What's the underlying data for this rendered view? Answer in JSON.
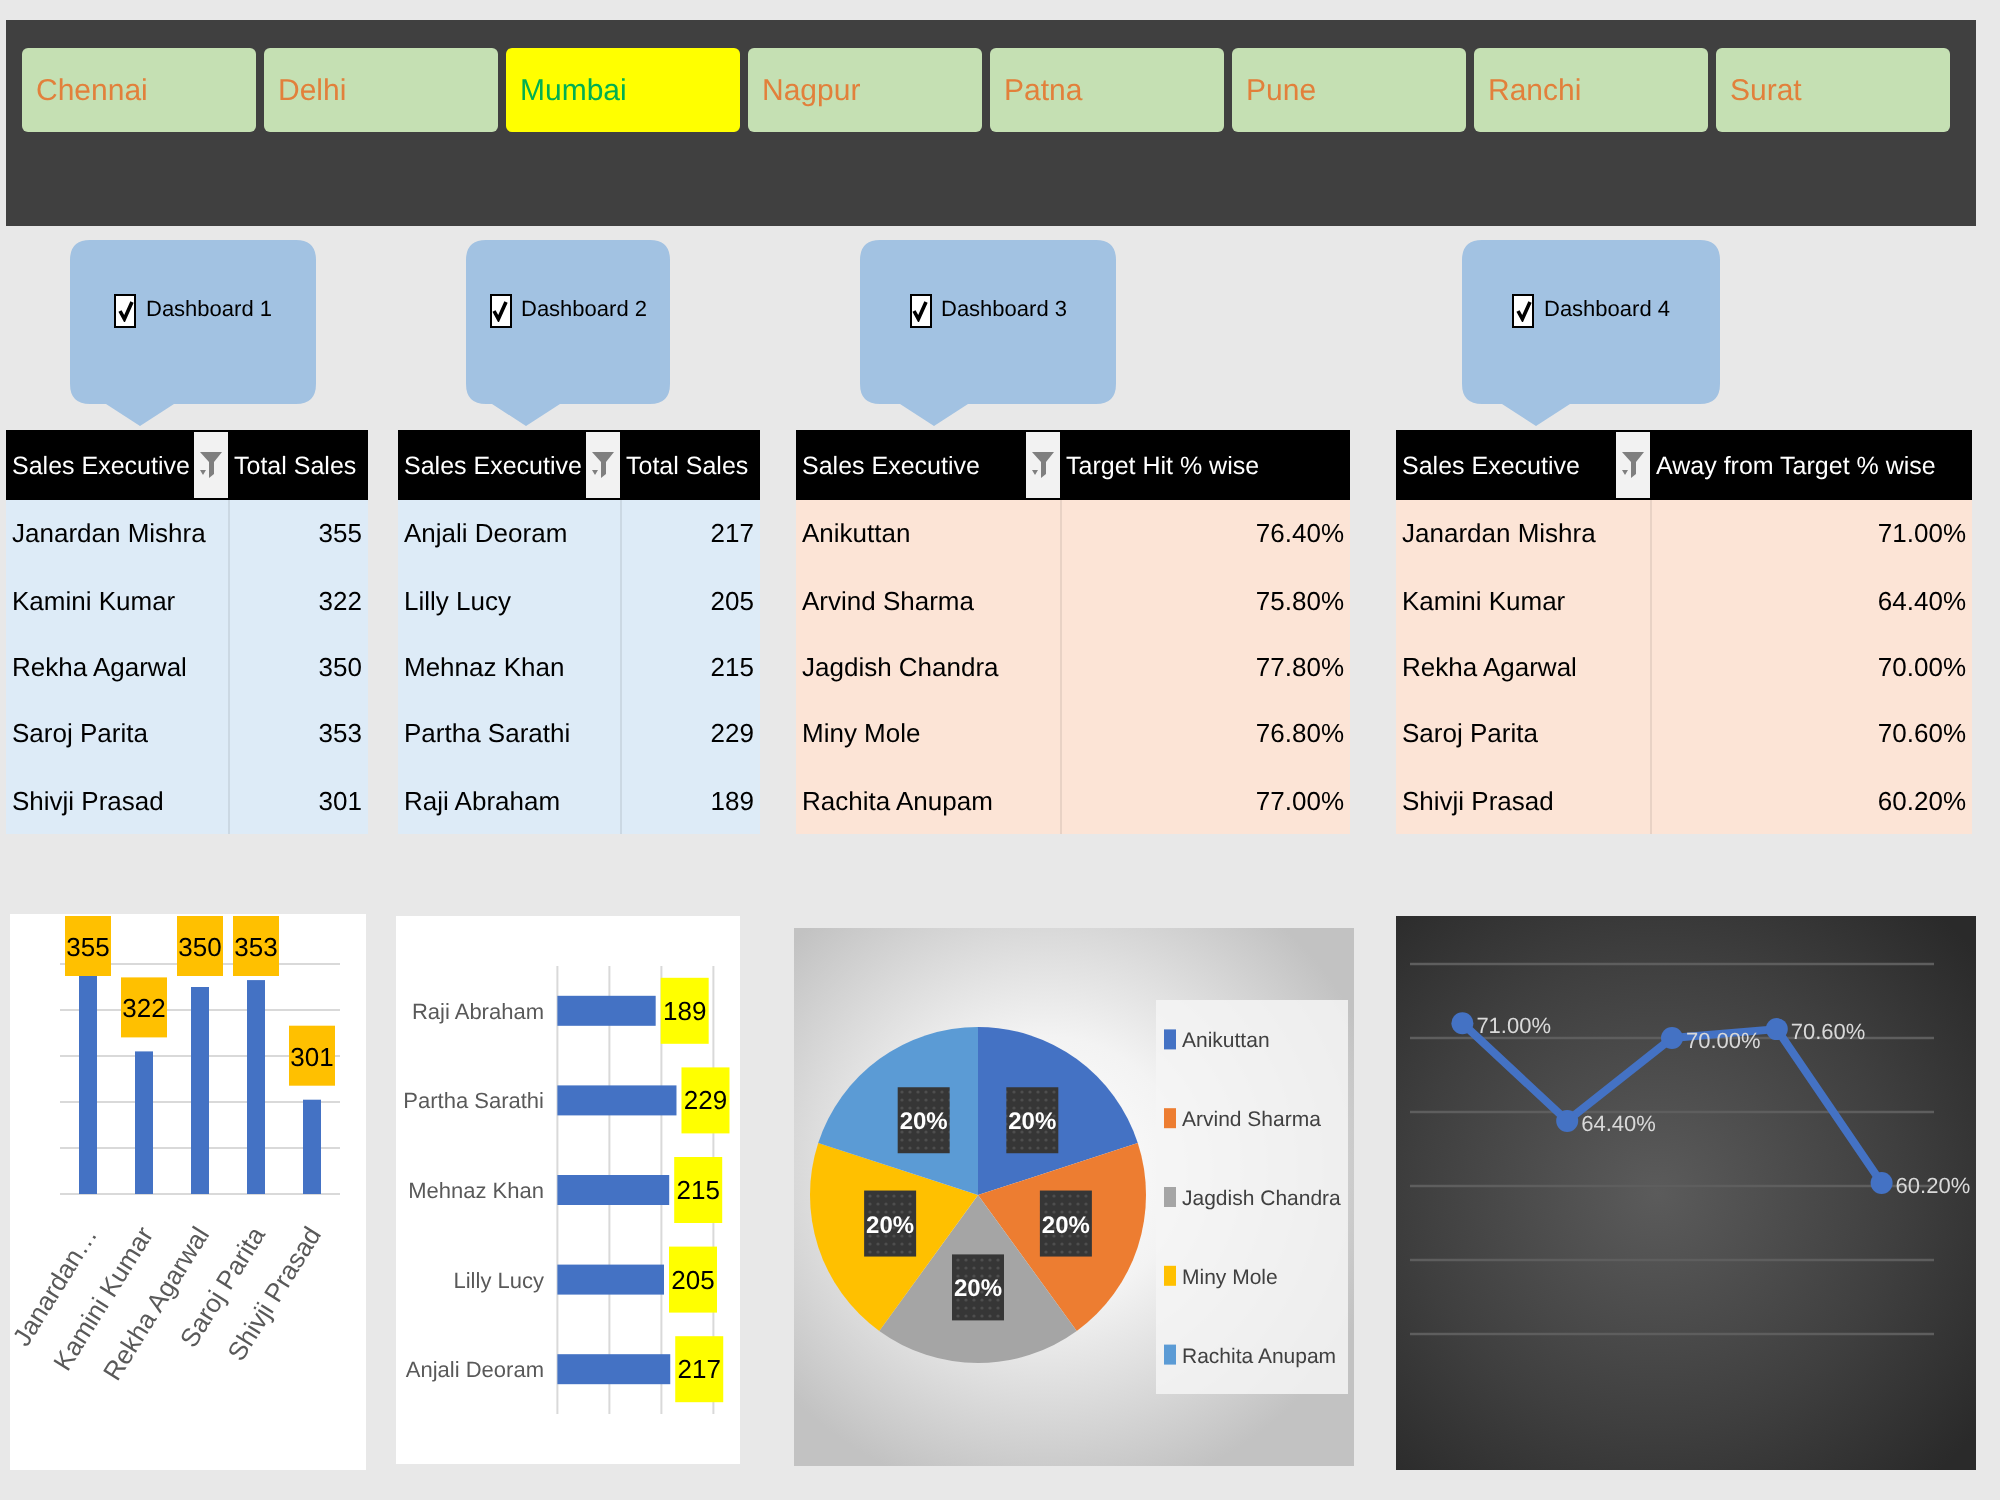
{
  "city_tabs": [
    {
      "label": "Chennai",
      "selected": false
    },
    {
      "label": "Delhi",
      "selected": false
    },
    {
      "label": "Mumbai",
      "selected": true
    },
    {
      "label": "Nagpur",
      "selected": false
    },
    {
      "label": "Patna",
      "selected": false
    },
    {
      "label": "Pune",
      "selected": false
    },
    {
      "label": "Ranchi",
      "selected": false
    },
    {
      "label": "Surat",
      "selected": false
    }
  ],
  "dashboards": [
    {
      "label": "Dashboard 1",
      "checked": true,
      "color": "#ddebf7",
      "columns": [
        {
          "label": "Sales Executive",
          "filter": true
        },
        {
          "label": "Total Sales",
          "filter": false
        }
      ],
      "rows": [
        [
          "Janardan Mishra",
          "355"
        ],
        [
          "Kamini Kumar",
          "322"
        ],
        [
          "Rekha Agarwal",
          "350"
        ],
        [
          "Saroj Parita",
          "353"
        ],
        [
          "Shivji Prasad",
          "301"
        ]
      ],
      "chart_data": [
        {
          "type": "bar",
          "categories": [
            "Janardan…",
            "Kamini Kumar",
            "Rekha Agarwal",
            "Saroj Parita",
            "Shivji Prasad"
          ],
          "values": [
            355,
            322,
            350,
            353,
            301
          ],
          "color": "#4472c4",
          "ylim": [
            260,
            360
          ],
          "yticks": [
            260,
            280,
            300,
            320,
            340,
            360
          ],
          "tick_labels": "x",
          "grid": true,
          "data_labels": true
        }
      ]
    },
    {
      "label": "Dashboard 2",
      "checked": true,
      "color": "#ddebf7",
      "columns": [
        {
          "label": "Sales Executive",
          "filter": true
        },
        {
          "label": "Total Sales",
          "filter": false
        }
      ],
      "rows": [
        [
          "Anjali Deoram",
          "217"
        ],
        [
          "Lilly Lucy",
          "205"
        ],
        [
          "Mehnaz Khan",
          "215"
        ],
        [
          "Partha Sarathi",
          "229"
        ],
        [
          "Raji Abraham",
          "189"
        ]
      ],
      "chart_data": [
        {
          "type": "bar",
          "orientation": "horizontal",
          "categories": [
            "Raji Abraham",
            "Partha Sarathi",
            "Mehnaz Khan",
            "Lilly Lucy",
            "Anjali Deoram"
          ],
          "values": [
            189,
            229,
            215,
            205,
            217
          ],
          "color": "#4472c4",
          "xlim": [
            0,
            300
          ],
          "xticks": [
            0,
            100,
            200,
            300
          ],
          "tick_labels": "y",
          "grid": true,
          "data_labels": true
        }
      ]
    },
    {
      "label": "Dashboard 3",
      "checked": true,
      "color": "#fce4d6",
      "columns": [
        {
          "label": "Sales Executive",
          "filter": true
        },
        {
          "label": "Target Hit % wise",
          "filter": false
        }
      ],
      "rows": [
        [
          "Anikuttan",
          "76.40%"
        ],
        [
          "Arvind Sharma",
          "75.80%"
        ],
        [
          "Jagdish Chandra",
          "77.80%"
        ],
        [
          "Miny Mole",
          "76.80%"
        ],
        [
          "Rachita Anupam",
          "77.00%"
        ]
      ],
      "chart_data": [
        {
          "type": "pie",
          "categories": [
            "Anikuttan",
            "Arvind Sharma",
            "Jagdish Chandra",
            "Miny Mole",
            "Rachita Anupam"
          ],
          "values": [
            20,
            20,
            20,
            20,
            20
          ],
          "colors": [
            "#4472c4",
            "#ed7d31",
            "#a5a5a5",
            "#ffc000",
            "#5b9bd5"
          ],
          "value_labels": [
            "20%",
            "20%",
            "20%",
            "20%",
            "20%"
          ],
          "legend": "right"
        }
      ]
    },
    {
      "label": "Dashboard 4",
      "checked": true,
      "color": "#fce4d6",
      "columns": [
        {
          "label": "Sales Executive",
          "filter": true
        },
        {
          "label": "Away from Target % wise",
          "filter": false
        }
      ],
      "rows": [
        [
          "Janardan Mishra",
          "71.00%"
        ],
        [
          "Kamini Kumar",
          "64.40%"
        ],
        [
          "Rekha Agarwal",
          "70.00%"
        ],
        [
          "Saroj Parita",
          "70.60%"
        ],
        [
          "Shivji Prasad",
          "60.20%"
        ]
      ],
      "chart_data": [
        {
          "type": "line",
          "values": [
            71.0,
            64.4,
            70.0,
            70.6,
            60.2
          ],
          "value_labels": [
            "71.00%",
            "64.40%",
            "70.00%",
            "70.60%",
            "60.20%"
          ],
          "color": "#4472c4",
          "ylim": [
            50,
            75
          ],
          "yticks": [
            50,
            55,
            60,
            65,
            70,
            75
          ],
          "tick_labels": false,
          "grid": true,
          "marker": "circle"
        }
      ]
    }
  ]
}
